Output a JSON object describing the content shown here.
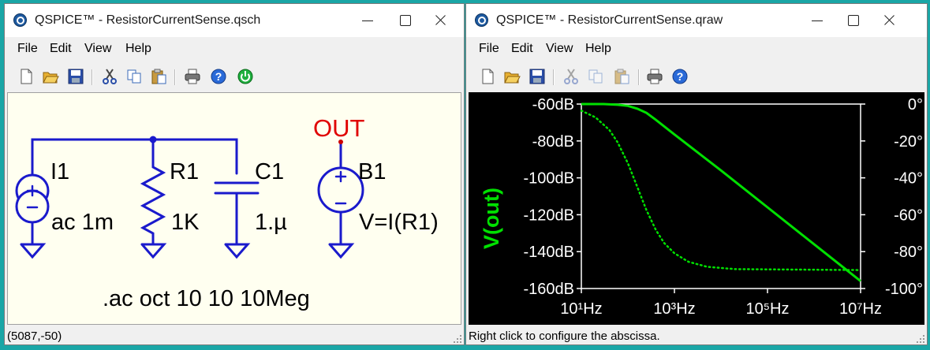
{
  "left_window": {
    "title": "QSPICE™ - ResistorCurrentSense.qsch",
    "menu": [
      "File",
      "Edit",
      "View",
      "Help"
    ],
    "toolbar_icons": [
      "new-icon",
      "open-icon",
      "save-icon",
      "cut-icon",
      "copy-icon",
      "paste-icon",
      "print-icon",
      "help-icon",
      "run-icon"
    ],
    "schematic": {
      "net_label": "OUT",
      "source": {
        "name": "I1",
        "value": "ac 1m"
      },
      "resistor": {
        "name": "R1",
        "value": "1K"
      },
      "capacitor": {
        "name": "C1",
        "value": "1.µ"
      },
      "bsource": {
        "name": "B1",
        "value": "V=I(R1)"
      },
      "directive": ".ac oct 10 10 10Meg"
    },
    "status": "(5087,-50)"
  },
  "right_window": {
    "title": "QSPICE™ - ResistorCurrentSense.qraw",
    "menu": [
      "File",
      "Edit",
      "View",
      "Help"
    ],
    "toolbar_icons": [
      "new-icon",
      "open-icon",
      "save-icon",
      "cut-icon",
      "copy-icon",
      "paste-icon",
      "print-icon",
      "help-icon"
    ],
    "status": "Right click to configure the abscissa."
  },
  "colors": {
    "desktop": "#1aa6a6",
    "schematic_wire": "#1a1acc",
    "net_label": "#e00000",
    "trace": "#00e000"
  },
  "chart_data": {
    "type": "line",
    "title": "",
    "ylabel": "V(out)",
    "x_scale": "log",
    "x_ticks": [
      "10¹Hz",
      "10³Hz",
      "10⁵Hz",
      "10⁷Hz"
    ],
    "x_tick_values": [
      10,
      1000,
      100000,
      10000000
    ],
    "xlim": [
      10,
      10000000
    ],
    "y_ticks": [
      "-60dB",
      "-80dB",
      "-100dB",
      "-120dB",
      "-140dB",
      "-160dB"
    ],
    "y_tick_values": [
      -60,
      -80,
      -100,
      -120,
      -140,
      -160
    ],
    "ylim": [
      -160,
      -60
    ],
    "y2_ticks": [
      "0°",
      "-20°",
      "-40°",
      "-60°",
      "-80°",
      "-100°"
    ],
    "y2_tick_values": [
      0,
      -20,
      -40,
      -60,
      -80,
      -100
    ],
    "y2lim": [
      -100,
      0
    ],
    "series": [
      {
        "style": "solid",
        "axis": "left",
        "x": [
          10,
          30,
          60,
          100,
          160,
          250,
          400,
          1000,
          10000,
          100000,
          1000000,
          10000000
        ],
        "y": [
          -60,
          -60,
          -60.4,
          -61,
          -62.5,
          -64.8,
          -68.6,
          -76.5,
          -96,
          -116,
          -136,
          -156
        ]
      },
      {
        "style": "dotted",
        "axis": "right",
        "x": [
          10,
          20,
          40,
          60,
          100,
          160,
          250,
          400,
          600,
          1000,
          2000,
          5000,
          20000,
          10000000
        ],
        "y": [
          -3.6,
          -7.2,
          -14,
          -20.7,
          -32.1,
          -45,
          -57.5,
          -68.3,
          -75.3,
          -80.9,
          -85.5,
          -88.2,
          -89.5,
          -90
        ]
      }
    ]
  }
}
